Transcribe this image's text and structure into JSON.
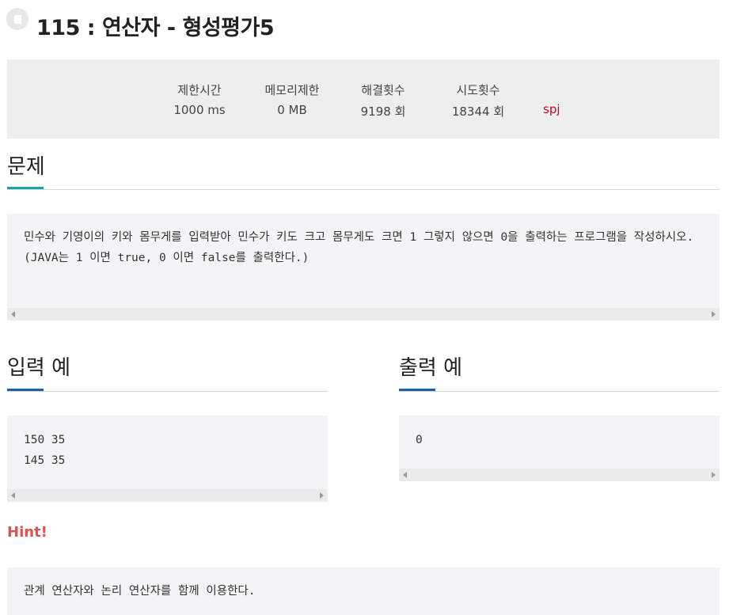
{
  "problem": {
    "title": "115 : 연산자 - 형성평가5"
  },
  "stats": [
    {
      "label": "제한시간",
      "value": "1000 ms"
    },
    {
      "label": "메모리제한",
      "value": "0 MB"
    },
    {
      "label": "해결횟수",
      "value": "9198 회"
    },
    {
      "label": "시도횟수",
      "value": "18344 회"
    }
  ],
  "spj": "spj",
  "sections": {
    "problem_heading": "문제",
    "problem_text": "민수와 기영이의 키와 몸무게를 입력받아 민수가 키도 크고 몸무게도 크면 1 그렇지 않으면 0을 출력하는 프로그램을 작성하시오.\n(JAVA는 1 이면 true, 0 이면 false를 출력한다.)",
    "input_heading": "입력 예",
    "input_text": "150 35\n145 35",
    "output_heading": "출력 예",
    "output_text": "0",
    "hint_heading": "Hint!",
    "hint_text": "관계 연산자와 논리 연산자를 함께 이용한다."
  },
  "colors": {
    "problem_accent": "#1aa3a3",
    "example_accent": "#1a5fa8",
    "hint": "#d9534f",
    "spj": "#d9000f"
  }
}
